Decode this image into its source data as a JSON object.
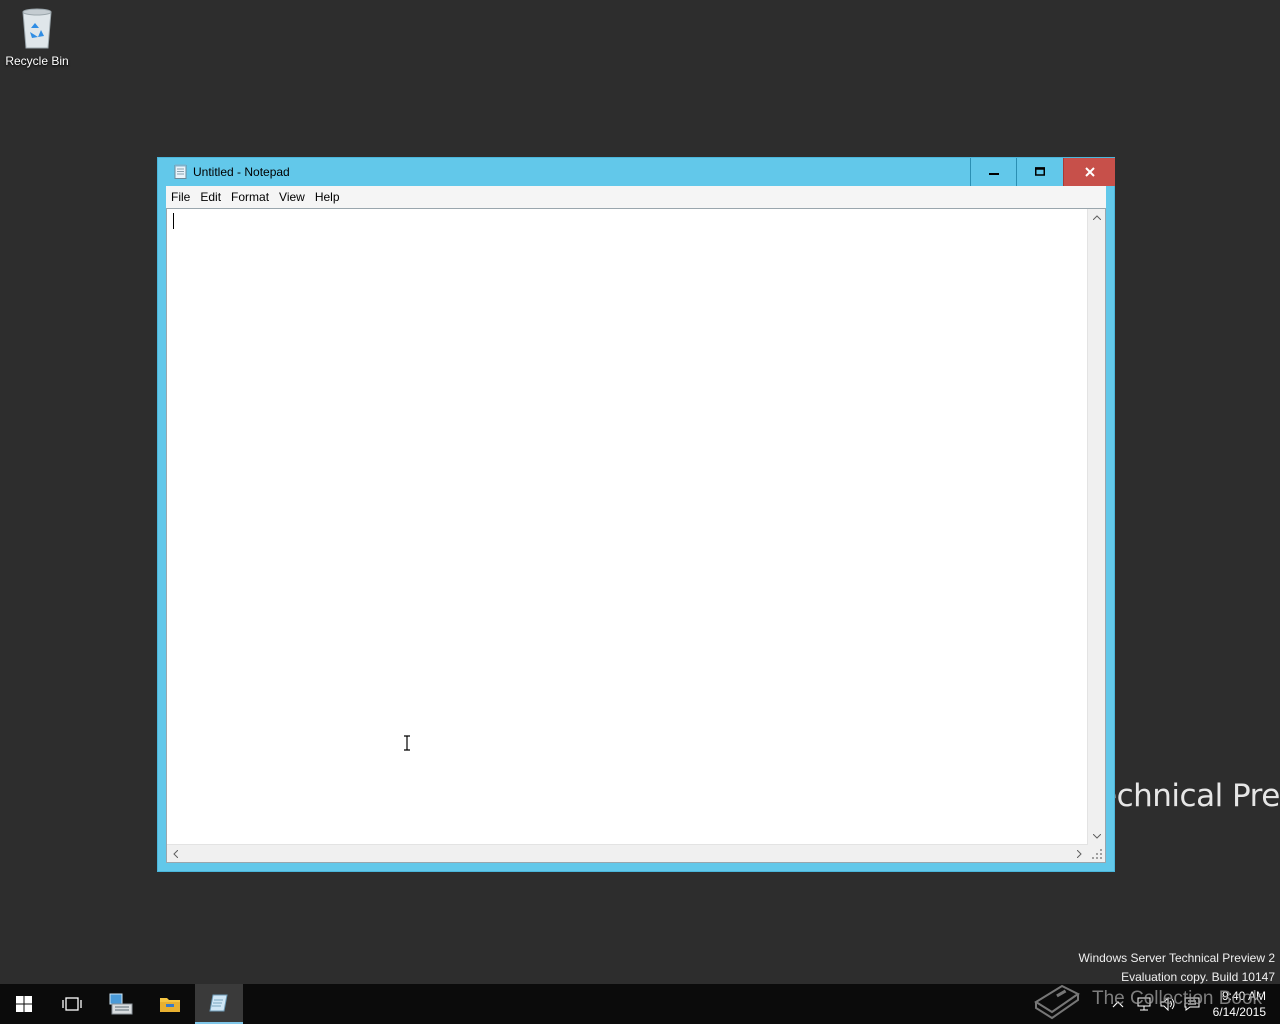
{
  "desktop": {
    "recycle_bin_label": "Recycle Bin",
    "wallpaper_text": "echnical Prev"
  },
  "watermark": {
    "line1": "Windows Server Technical Preview 2",
    "line2": "Evaluation copy. Build 10147"
  },
  "window": {
    "title": "Untitled - Notepad",
    "menu": [
      "File",
      "Edit",
      "Format",
      "View",
      "Help"
    ],
    "content": ""
  },
  "taskbar": {
    "time": "9:40 AM",
    "date": "6/14/2015",
    "overlay_text": "The Collection Book"
  },
  "colors": {
    "title_bar": "#62c8ea",
    "close_button": "#c7504a",
    "desktop": "#2d2d2d",
    "taskbar": "#0b0b0b"
  }
}
